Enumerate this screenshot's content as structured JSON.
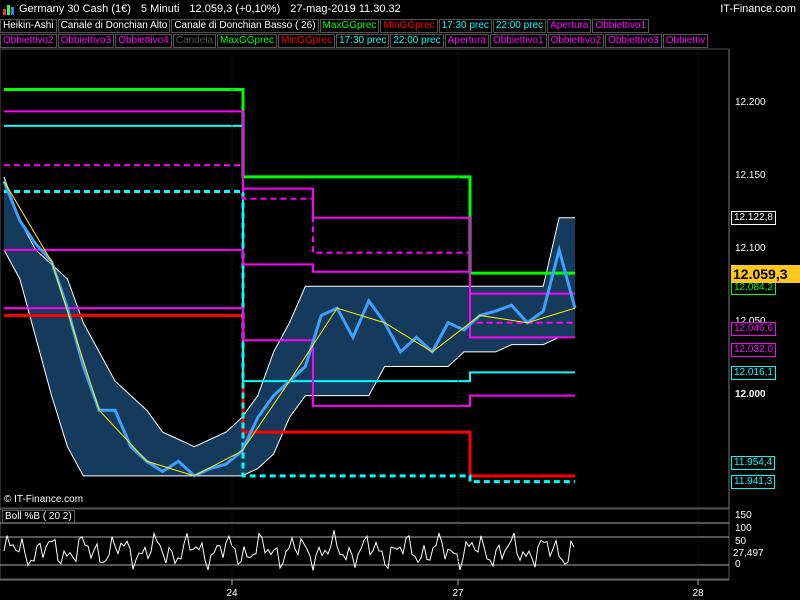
{
  "header": {
    "instrument": "Germany 30 Cash (1€)",
    "timeframe": "5 Minuti",
    "price": "12.059,3 (+0,10%)",
    "datetime": "27-mag-2019 11.30.32",
    "brand": "IT-Finance.com"
  },
  "legend_row1": [
    "Heikin-Ashi",
    "Canale di Donchian Alto",
    "Canale di Donchian Basso ( 26)",
    "MaxGGprec",
    "MinGGprec",
    "17:30 prec",
    "22:00 prec",
    "Apertura",
    "Obbiettivo1"
  ],
  "legend_row2": [
    "Obbiettivo2",
    "Obbiettivo3",
    "Obbiettivo4",
    "Candela",
    "MaxGGprec",
    "MinGGprec",
    "17:30 prec",
    "22:00 prec",
    "Apertura",
    "Obbiettivo1",
    "Obbiettivo2",
    "Obbiettivo3",
    "Obbiettiv"
  ],
  "legend_colors": {
    "Heikin-Ashi": "#ffffff",
    "Canale di Donchian Alto": "#ffffff",
    "Canale di Donchian Basso ( 26)": "#ffffff",
    "MaxGGprec": "#00ff00",
    "MinGGprec": "#ff0000",
    "17:30 prec": "#00ffff",
    "22:00 prec": "#00ffff",
    "Apertura": "#ff00ff",
    "Obbiettivo1": "#ff00ff",
    "Obbiettivo2": "#ff00ff",
    "Obbiettivo3": "#ff00ff",
    "Obbiettivo4": "#ff00ff",
    "Candela": "#555555",
    "Obbiettiv": "#ff00ff"
  },
  "footer": {
    "copyright": "© IT-Finance.com"
  },
  "indicator": {
    "title": "Boll %B ( 20 2)",
    "last_value": "27,497",
    "ticks": [
      "150",
      "100",
      "50",
      "0"
    ]
  },
  "chart_data": {
    "type": "line",
    "title": "Germany 30 Cash (1€)",
    "x_ticks": [
      "24",
      "27",
      "28"
    ],
    "y_ticks": [
      "12.200",
      "12.150",
      "12.100",
      "12.050",
      "12.000",
      "11.950"
    ],
    "ylim": [
      11.925,
      12.235
    ],
    "last_price": "12.059,3",
    "price_labels": [
      {
        "label": "12.122,8",
        "value": 12.1228,
        "color": "#ffffff"
      },
      {
        "label": "12.084,2",
        "value": 12.0842,
        "color": "#00ff00"
      },
      {
        "label": "12.084,2",
        "value": 12.0842,
        "color": "#00ff00"
      },
      {
        "label": "12.046,6",
        "value": 12.0466,
        "color": "#ff00ff"
      },
      {
        "label": "12.032,0",
        "value": 12.032,
        "color": "#ff00ff"
      },
      {
        "label": "12.016,1",
        "value": 12.0161,
        "color": "#00ffff"
      },
      {
        "label": "11.954,4",
        "value": 11.9544,
        "color": "#00ffff"
      },
      {
        "label": "11.941,3",
        "value": 11.9413,
        "color": "#00ffff"
      }
    ],
    "series": [
      {
        "name": "Heikin-Ashi",
        "values": [
          12.147,
          12.12,
          12.104,
          12.092,
          12.06,
          12.02,
          11.99,
          11.99,
          11.965,
          11.955,
          11.948,
          11.955,
          11.945,
          11.95,
          11.953,
          11.962,
          11.985,
          12.0,
          12.01,
          12.02,
          12.055,
          12.06,
          12.04,
          12.065,
          12.05,
          12.03,
          12.04,
          12.03,
          12.05,
          12.045,
          12.055,
          12.058,
          12.062,
          12.05,
          12.058,
          12.1,
          12.06
        ]
      },
      {
        "name": "Canale di Donchian Alto",
        "values": [
          12.15,
          12.12,
          12.1,
          12.09,
          12.08,
          12.05,
          12.03,
          12.01,
          12.0,
          11.99,
          11.975,
          11.97,
          11.965,
          11.97,
          11.975,
          11.985,
          12.0,
          12.03,
          12.05,
          12.075,
          12.075,
          12.075,
          12.075,
          12.075,
          12.075,
          12.075,
          12.075,
          12.075,
          12.075,
          12.075,
          12.075,
          12.075,
          12.075,
          12.075,
          12.075,
          12.122,
          12.122
        ]
      },
      {
        "name": "Canale di Donchian Basso ( 26)",
        "values": [
          12.1,
          12.08,
          12.04,
          12.0,
          11.965,
          11.945,
          11.945,
          11.945,
          11.945,
          11.945,
          11.945,
          11.945,
          11.945,
          11.945,
          11.945,
          11.945,
          11.95,
          11.96,
          11.985,
          12.0,
          12.0,
          12.0,
          12.0,
          12.0,
          12.02,
          12.02,
          12.02,
          12.02,
          12.02,
          12.03,
          12.03,
          12.03,
          12.035,
          12.035,
          12.035,
          12.04,
          12.04
        ]
      },
      {
        "name": "MaxGGprec",
        "values": [
          12.21,
          12.15,
          12.084
        ]
      },
      {
        "name": "MinGGprec",
        "values": [
          12.055,
          11.975,
          11.945
        ]
      },
      {
        "name": "17:30 prec",
        "values": [
          12.185,
          12.01,
          12.016
        ]
      },
      {
        "name": "22:00 prec",
        "values": [
          12.14,
          11.945,
          11.941
        ]
      }
    ]
  }
}
